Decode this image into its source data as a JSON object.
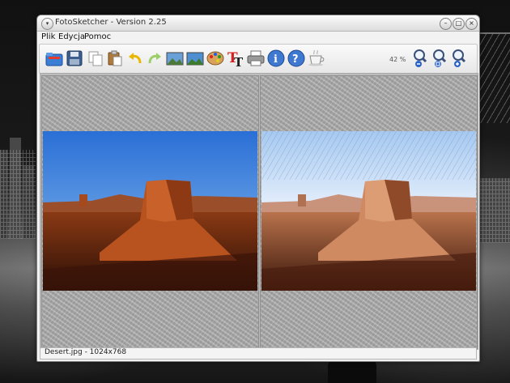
{
  "window": {
    "title": "FotoSketcher - Version 2.25",
    "menu_glyph": "▾",
    "btn_min": "–",
    "btn_max": "□",
    "btn_close": "×"
  },
  "menu": {
    "file": "Plik",
    "edit": "Edycja",
    "help": "Pomoc"
  },
  "toolbar": {
    "zoom_level": "42 %",
    "icons": [
      "open-icon",
      "save-icon",
      "copy-icon",
      "paste-icon",
      "undo-icon",
      "redo-icon",
      "original-image-icon",
      "result-image-icon",
      "palette-icon",
      "text-icon",
      "print-icon",
      "info-icon",
      "help-icon",
      "coffee-icon",
      "zoom-out-icon",
      "zoom-fit-icon",
      "zoom-in-icon"
    ]
  },
  "status": {
    "text": "Desert.jpg - 1024x768"
  },
  "colors": {
    "sky": "#2a6fd6",
    "rock": "#b8521f",
    "ground": "#4a1c0c",
    "sketch_sky": "#e8f2ff"
  }
}
